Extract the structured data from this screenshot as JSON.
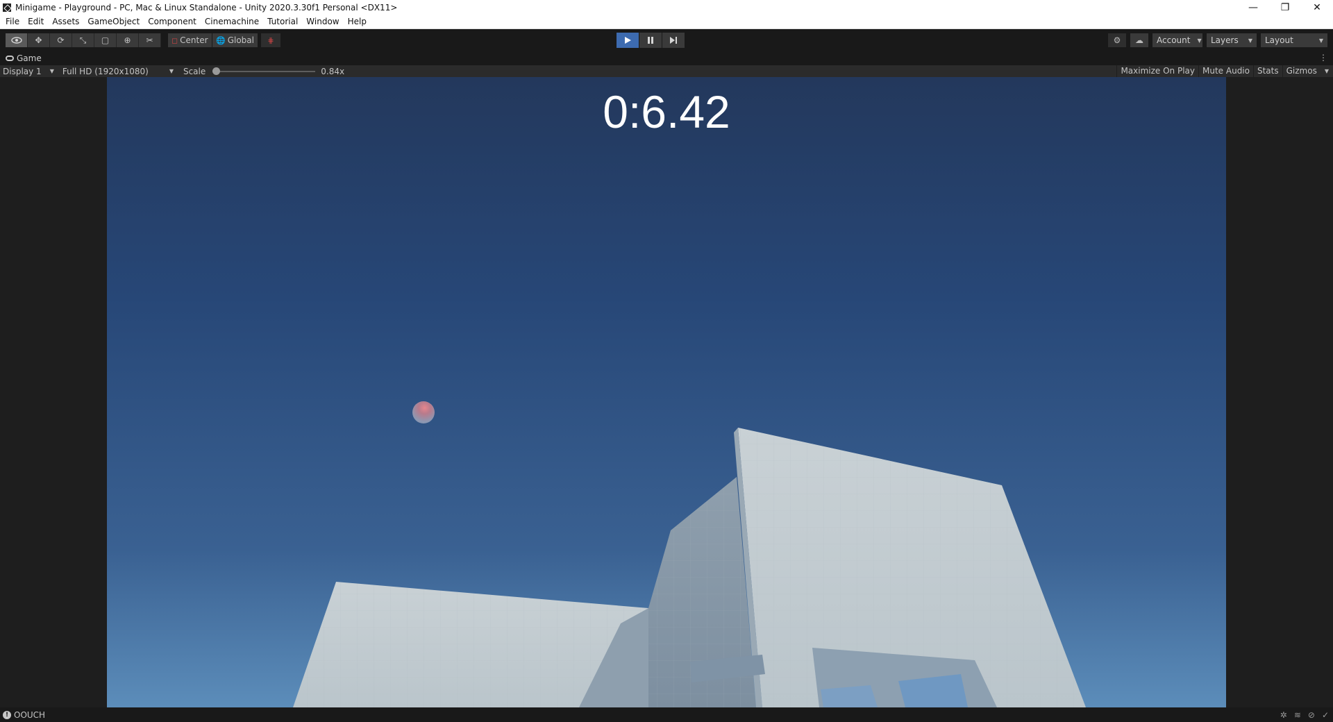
{
  "window": {
    "title": "Minigame - Playground - PC, Mac & Linux Standalone - Unity 2020.3.30f1 Personal <DX11>",
    "minimize_glyph": "—",
    "restore_glyph": "❐",
    "close_glyph": "✕"
  },
  "menu": {
    "items": [
      "File",
      "Edit",
      "Assets",
      "GameObject",
      "Component",
      "Cinemachine",
      "Tutorial",
      "Window",
      "Help"
    ]
  },
  "toolbar": {
    "tools": [
      {
        "name": "view-tool-icon",
        "glyph": "👁"
      },
      {
        "name": "move-tool-icon",
        "glyph": "✥"
      },
      {
        "name": "rotate-tool-icon",
        "glyph": "⟳"
      },
      {
        "name": "scale-tool-icon",
        "glyph": "⤡"
      },
      {
        "name": "rect-tool-icon",
        "glyph": "▢"
      },
      {
        "name": "transform-tool-icon",
        "glyph": "⊕"
      },
      {
        "name": "custom-tool-icon",
        "glyph": "✂"
      }
    ],
    "pivot_mode": "Center",
    "pivot_rotation": "Global",
    "account_label": "Account",
    "layers_label": "Layers",
    "layout_label": "Layout"
  },
  "game_tab": {
    "label": "Game"
  },
  "game_bar": {
    "display": "Display 1",
    "resolution": "Full HD (1920x1080)",
    "scale_label": "Scale",
    "scale_value": "0.84x",
    "scale_fraction": 0.0,
    "maximize_on_play": "Maximize On Play",
    "mute_audio": "Mute Audio",
    "stats": "Stats",
    "gizmos": "Gizmos"
  },
  "game_view": {
    "timer": "0:6.42"
  },
  "status": {
    "message": "OOUCH"
  },
  "colors": {
    "play_active": "#3d6bb0",
    "sky_top": "#23385c",
    "sky_bottom": "#5c8dba",
    "wall": "#c3cdd2"
  }
}
